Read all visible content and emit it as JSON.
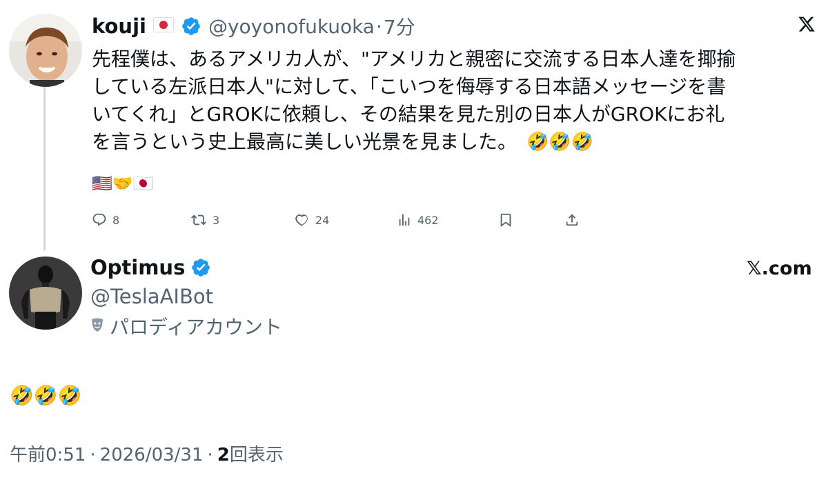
{
  "tweet": {
    "author_name": "kouji",
    "author_flag": "🇯🇵",
    "handle": "@yoyonofukuoka",
    "separator": "·",
    "time_ago": "7分",
    "text_lines": [
      "先程僕は、あるアメリカ人が、\"アメリカと親密に交流する日本人達を揶揄",
      "している左派日本人\"に対して、「こいつを侮辱する日本語メッセージを書",
      "いてくれ」とGROKに依頼し、その結果を見た別の日本人がGROKにお礼",
      "を言うという史上最高に美しい光景を見ました。"
    ],
    "trailing_emoji": "🤣🤣🤣",
    "flags_line": "🇺🇸🤝🇯🇵",
    "actions": {
      "replies": "8",
      "retweets": "3",
      "likes": "24",
      "views": "462"
    },
    "x_logo": "𝕏"
  },
  "reply": {
    "author_name": "Optimus",
    "handle": "@TeslaAIBot",
    "parody_label": "パロディアカウント",
    "x_com": "𝕏.com",
    "text": "🤣🤣🤣"
  },
  "footer": {
    "time": "午前0:51",
    "dot1": "·",
    "date": "2026/03/31",
    "dot2": "·",
    "views_count": "2",
    "views_label": "回表示"
  },
  "colors": {
    "verified": "#1d9bf0",
    "muted": "#536471",
    "text": "#0f1419",
    "thread_line": "#cfd9de"
  },
  "icons": [
    "reply-icon",
    "retweet-icon",
    "like-icon",
    "views-icon",
    "bookmark-icon",
    "share-icon",
    "verified-icon",
    "x-logo-icon",
    "parody-mask-icon"
  ]
}
